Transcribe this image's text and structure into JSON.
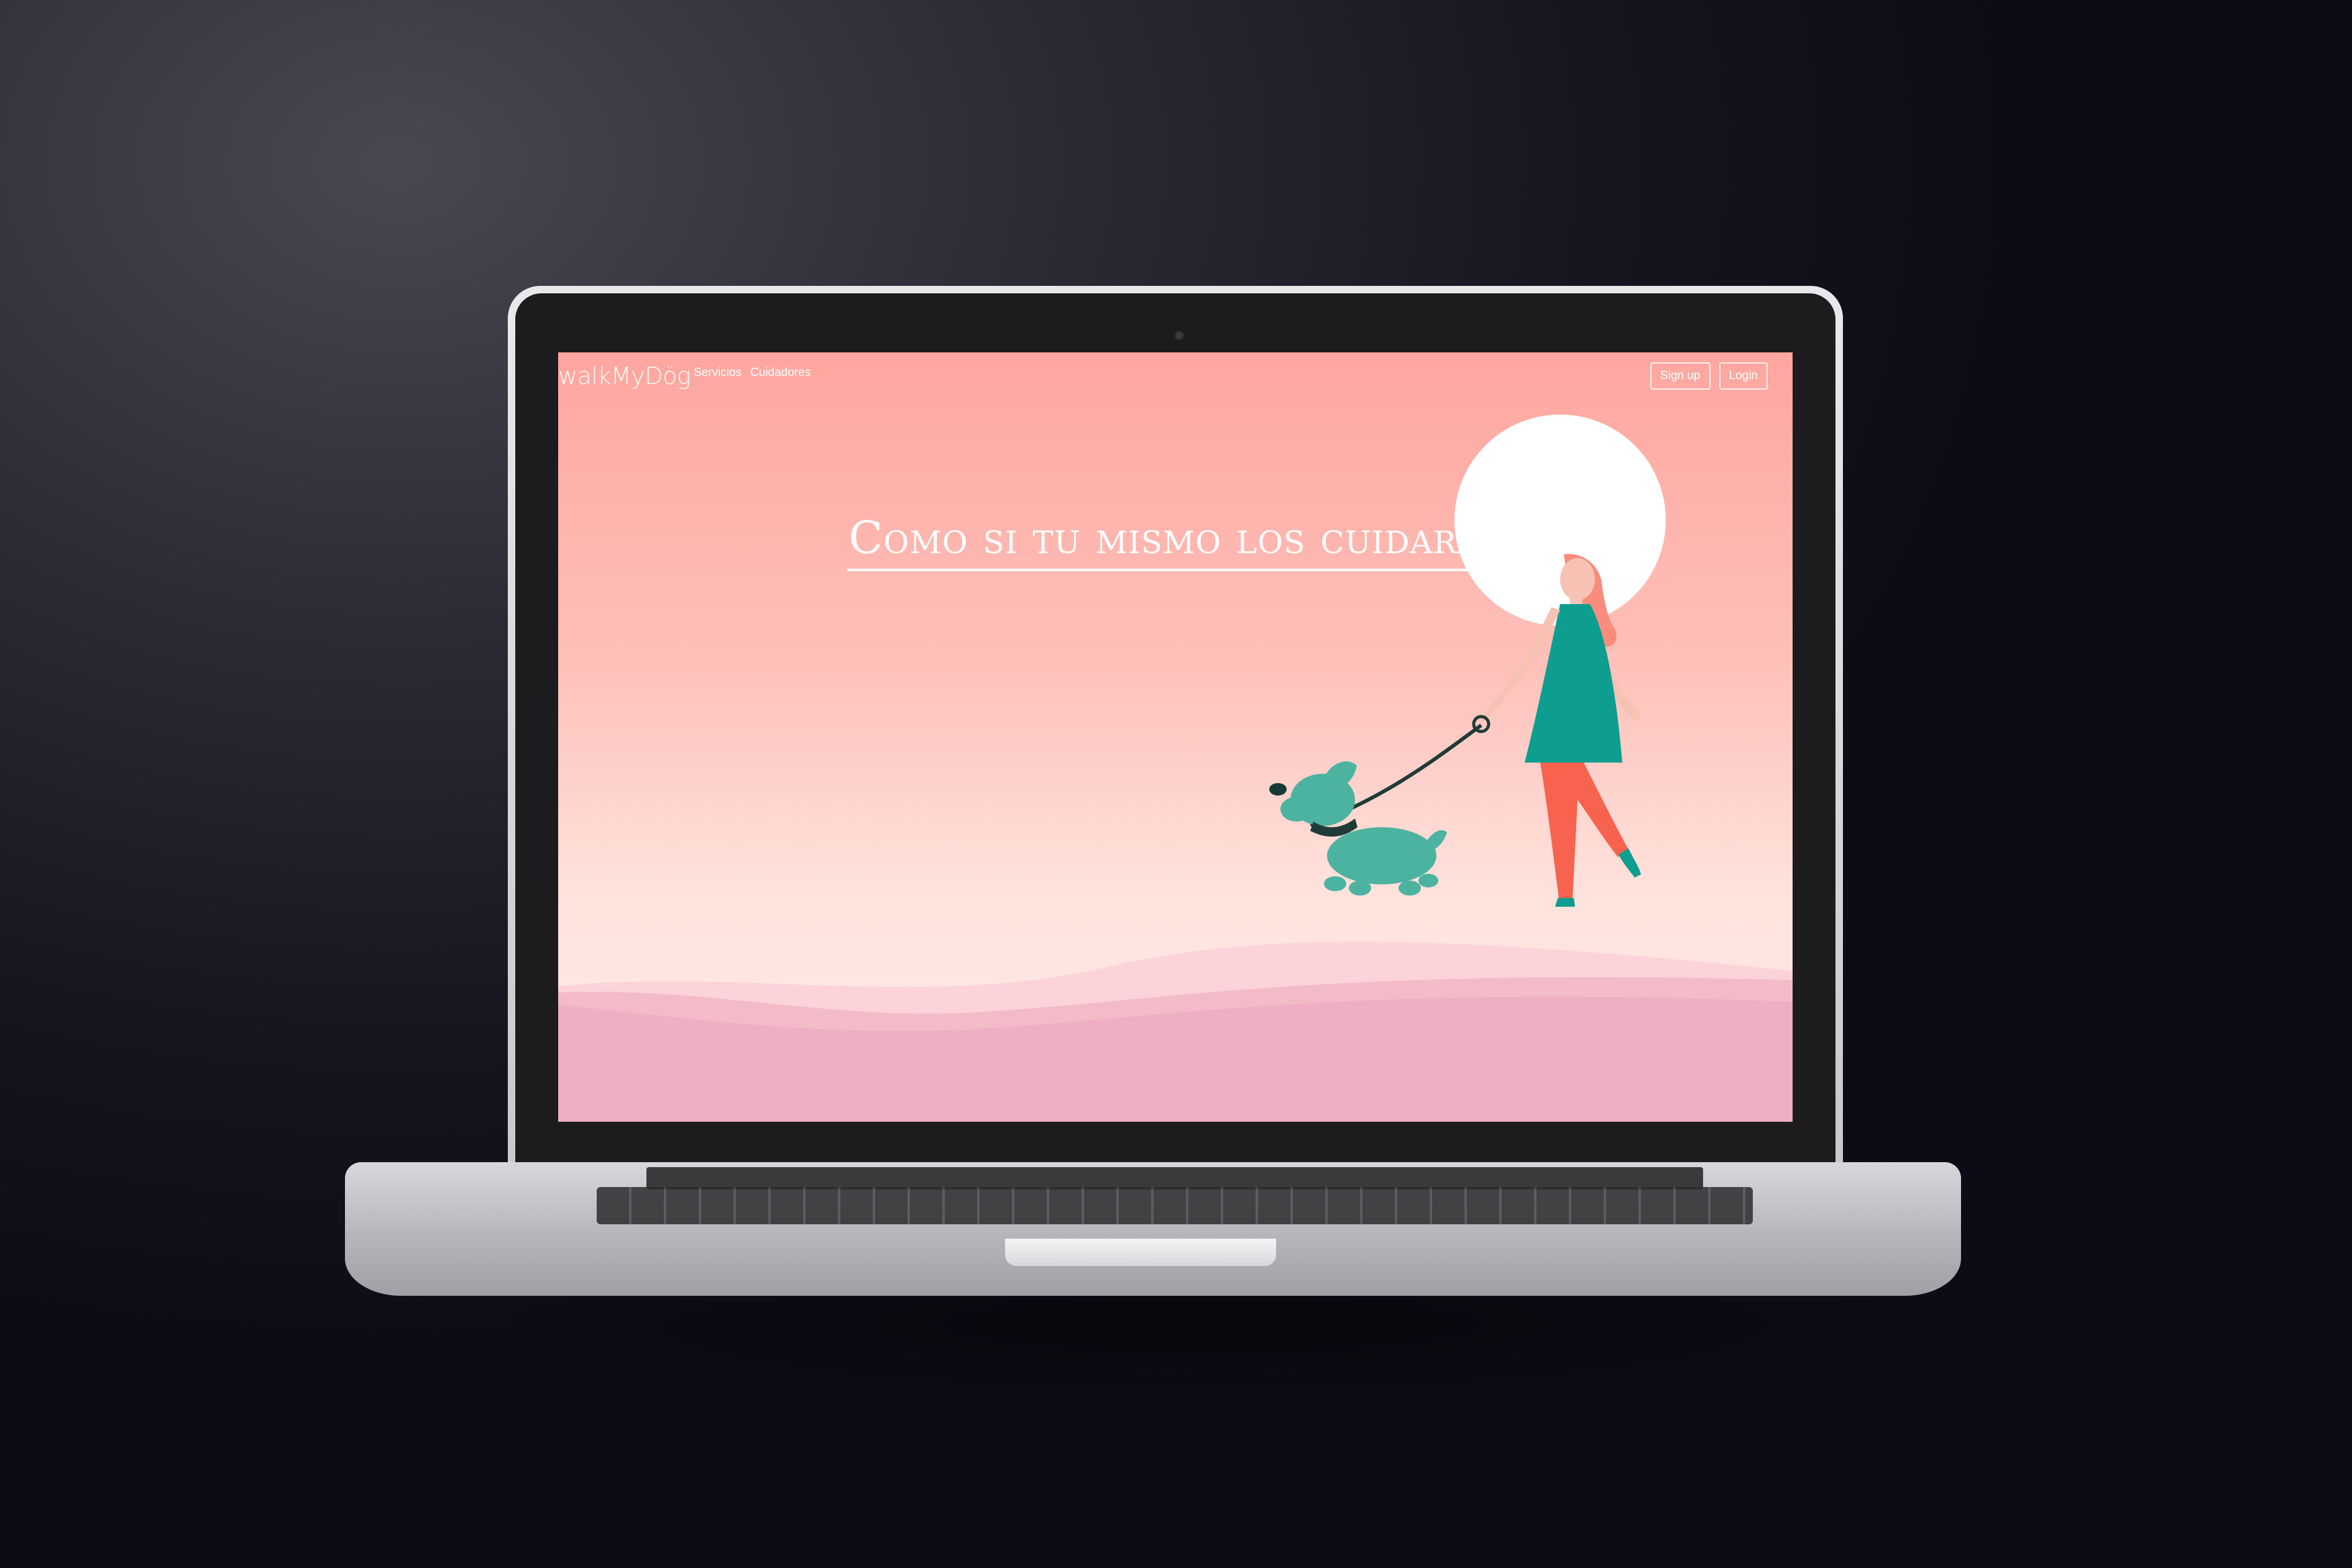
{
  "navbar": {
    "logo": "walkMyDög",
    "links": [
      "Servicios",
      "Cuidadores"
    ],
    "signup_label": "Sign up",
    "login_label": "Login"
  },
  "hero": {
    "title": "Como si tu mismo los cuidaras"
  },
  "colors": {
    "background_top": "#fea69f",
    "background_bottom": "#ffe4de",
    "hills": "#f0aec0",
    "teal": "#0d9e8f",
    "dog": "#4db3a1",
    "pants": "#f7634e",
    "hair": "#f98c7c",
    "sun": "#ffffff"
  }
}
